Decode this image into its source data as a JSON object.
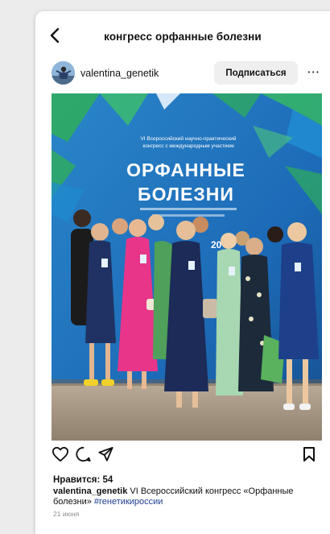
{
  "header": {
    "title": "конгресс орфанные болезни",
    "back_icon": "chevron-left-icon"
  },
  "post": {
    "username": "valentina_genetik",
    "follow_label": "Подписаться",
    "more_label": "···",
    "photo": {
      "banner_line1": "VI Всероссийский научно-практический",
      "banner_line2": "конгресс с международным участием",
      "banner_title1": "ОРФАННЫЕ",
      "banner_title2": "БОЛЕЗНИ",
      "banner_year": "20"
    },
    "actions": {
      "like_icon": "heart-icon",
      "comment_icon": "comment-icon",
      "share_icon": "send-icon",
      "save_icon": "bookmark-icon"
    },
    "likes_label": "Нравится: 54",
    "caption": {
      "username": "valentina_genetik",
      "text": " VI Всероссийский конгресс «Орфанные болезни» ",
      "hashtag": "#генетикироссии"
    },
    "date": "21 июня"
  },
  "colors": {
    "banner_blue": "#1d6bb8",
    "banner_green": "#2fae5a",
    "dress_pink": "#e8358a",
    "dress_navy": "#1c2b57",
    "hashtag": "#1d3d8f"
  }
}
